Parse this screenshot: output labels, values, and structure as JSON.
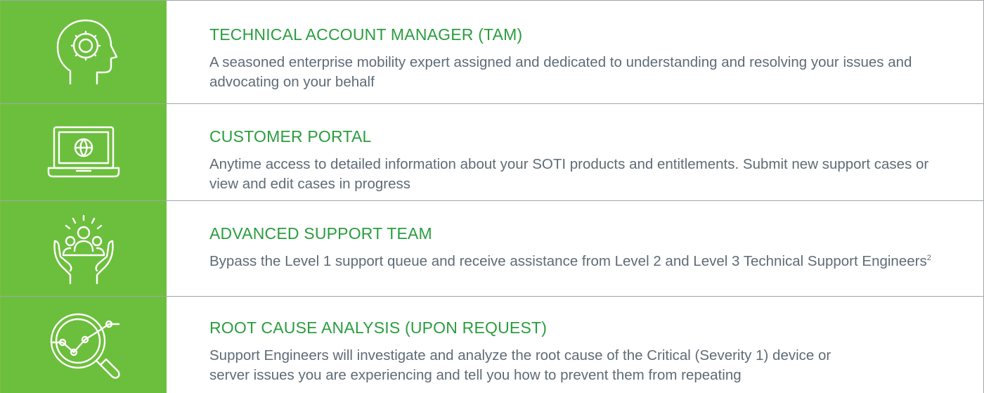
{
  "colors": {
    "icon_background": "#6cbf3c",
    "title": "#2a9d3f",
    "body_text": "#5f6b76",
    "rule": "#9fa6ad",
    "icon_stroke": "#ffffff"
  },
  "features": [
    {
      "icon": "head-gear-icon",
      "title": "TECHNICAL ACCOUNT MANAGER (TAM)",
      "description": "A seasoned enterprise mobility expert assigned and dedicated to understanding and resolving your issues and advocating on your behalf"
    },
    {
      "icon": "laptop-globe-icon",
      "title": "CUSTOMER PORTAL",
      "description": "Anytime access to detailed information about your SOTI products and entitlements. Submit new support cases or view and edit cases in progress"
    },
    {
      "icon": "hands-team-icon",
      "title": "ADVANCED SUPPORT TEAM",
      "description": "Bypass the Level 1 support queue and receive assistance from Level 2 and Level 3 Technical Support Engineers",
      "footnote": "2"
    },
    {
      "icon": "magnifier-chart-icon",
      "title": "ROOT CAUSE ANALYSIS (UPON REQUEST)",
      "description": "Support Engineers will investigate and analyze the root cause of the Critical (Severity 1) device or server issues you are experiencing and tell you how to prevent them from repeating"
    }
  ]
}
